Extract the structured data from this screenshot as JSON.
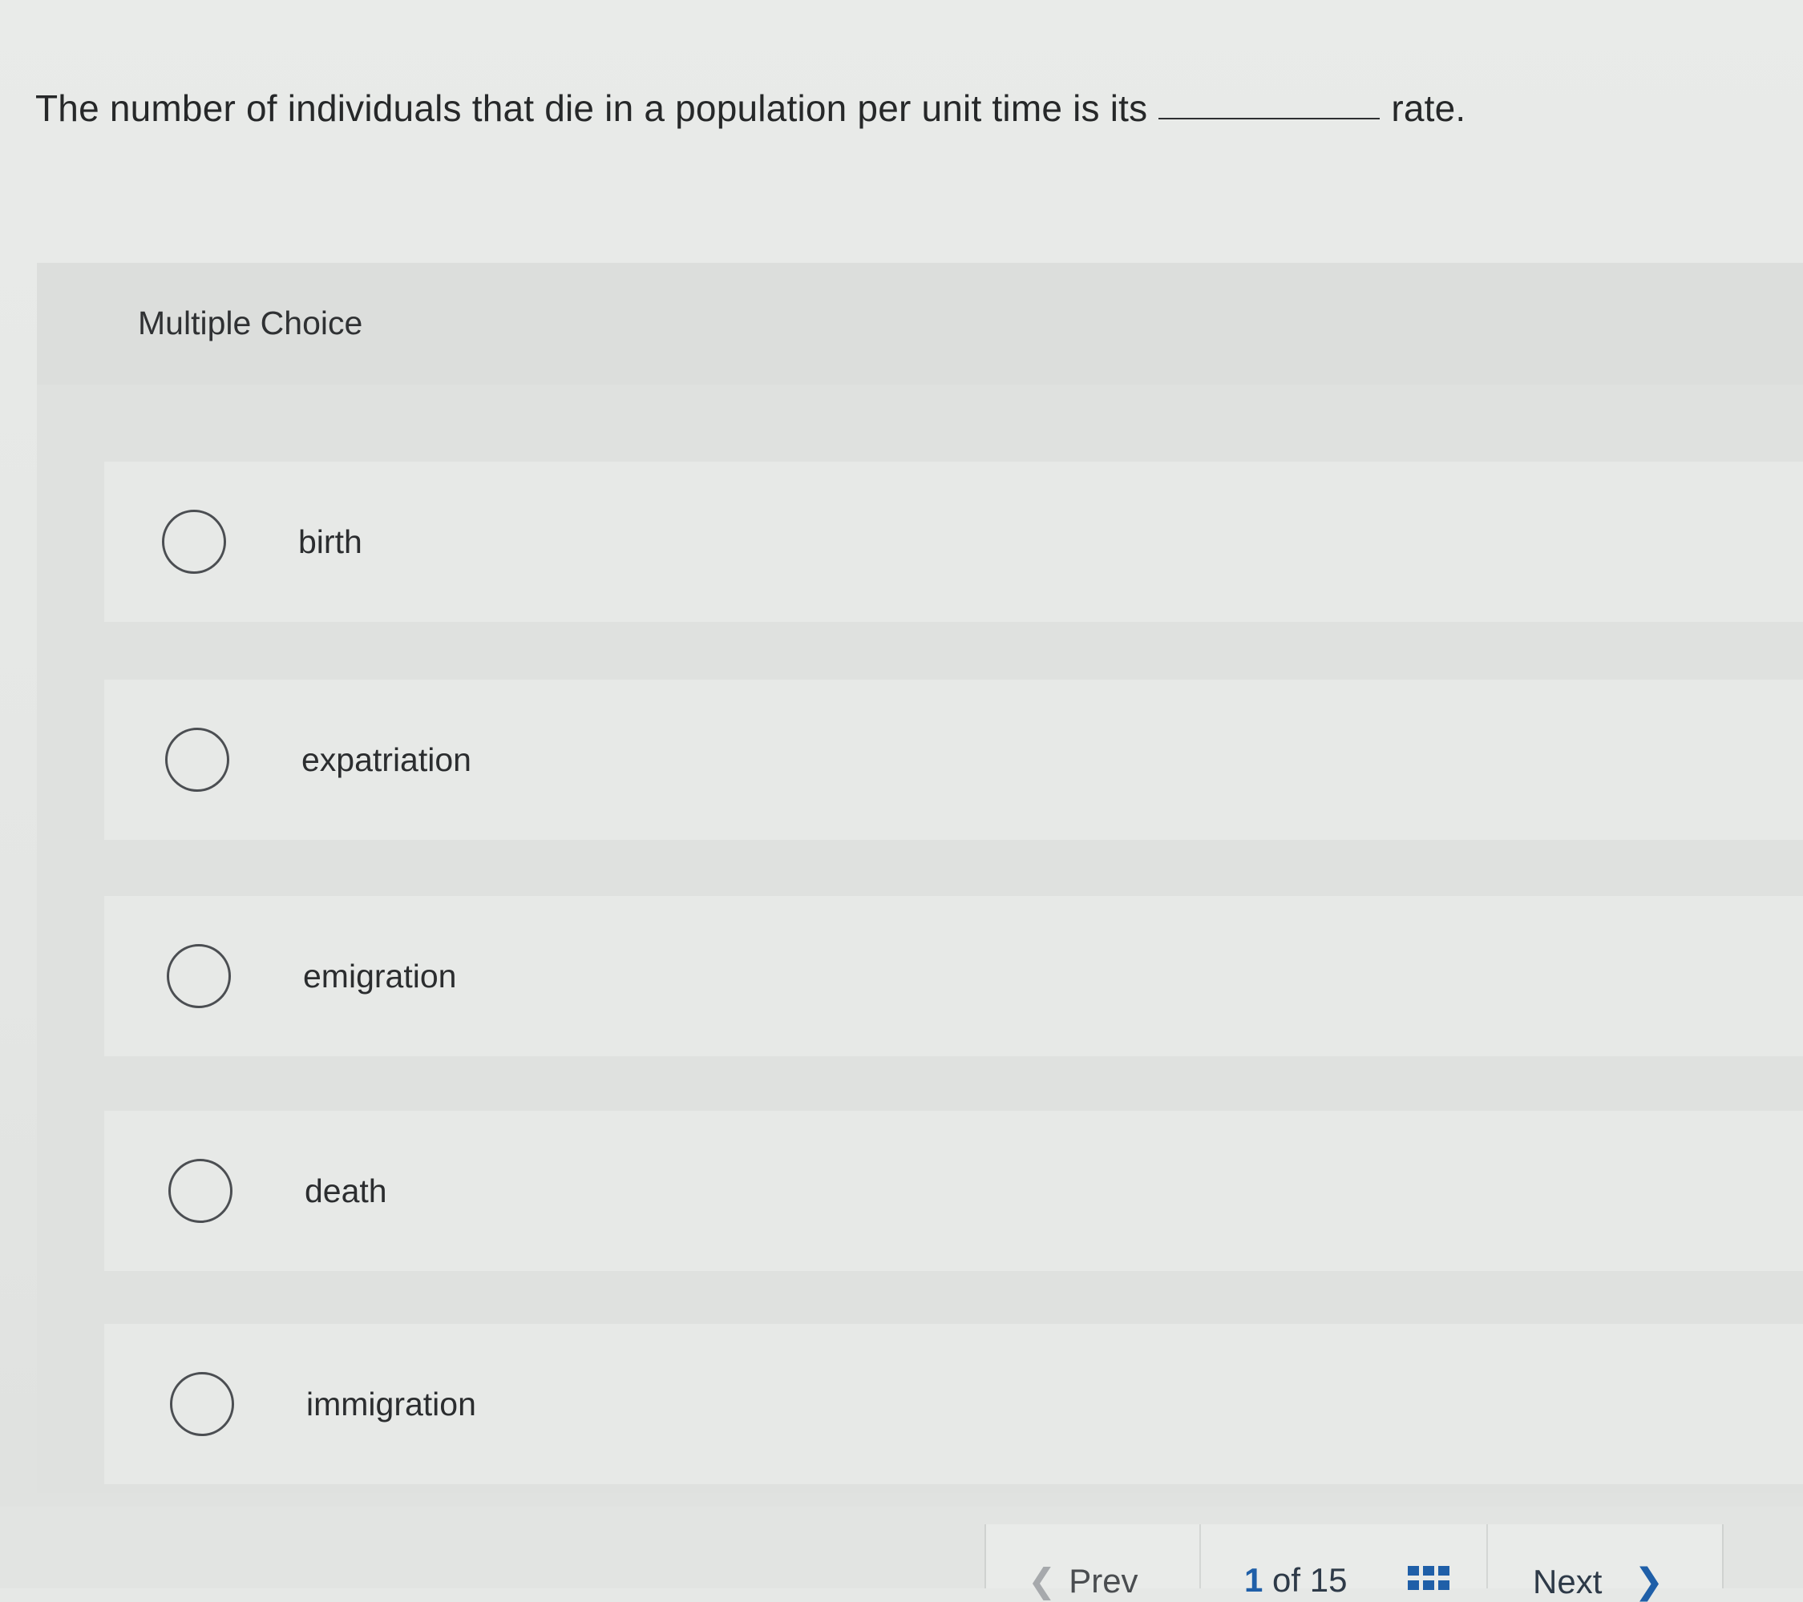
{
  "question": {
    "text_before": "The number of individuals that die in a population per unit time is its",
    "text_after": "rate."
  },
  "multiple_choice": {
    "title": "Multiple Choice",
    "options": [
      {
        "label": "birth",
        "selected": false
      },
      {
        "label": "expatriation",
        "selected": false
      },
      {
        "label": "emigration",
        "selected": false
      },
      {
        "label": "death",
        "selected": false
      },
      {
        "label": "immigration",
        "selected": false
      }
    ]
  },
  "navigation": {
    "prev_label": "Prev",
    "current_page": "1",
    "of_label": "of",
    "total_pages": "15",
    "next_label": "Next",
    "grid_icon": "grid-icon",
    "prev_icon": "chevron-left-icon",
    "next_icon": "chevron-right-icon",
    "accent_color": "#1f5fa8"
  }
}
